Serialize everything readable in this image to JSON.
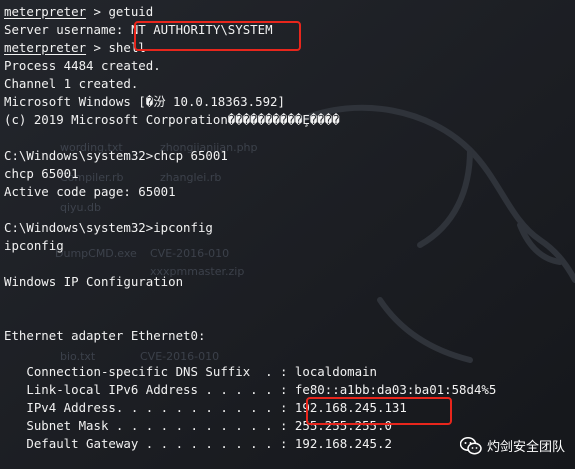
{
  "terminal": {
    "lines": [
      {
        "parts": [
          {
            "text": "meterpreter",
            "u": true
          },
          {
            "text": " > getuid"
          }
        ]
      },
      {
        "parts": [
          {
            "text": "Server username: NT AUTHORITY\\SYSTEM"
          }
        ]
      },
      {
        "parts": [
          {
            "text": "meterpreter",
            "u": true
          },
          {
            "text": " > shell"
          }
        ]
      },
      {
        "parts": [
          {
            "text": "Process 4484 created."
          }
        ]
      },
      {
        "parts": [
          {
            "text": "Channel 1 created."
          }
        ]
      },
      {
        "parts": [
          {
            "text": "Microsoft Windows [�汾 10.0.18363.592]"
          }
        ]
      },
      {
        "parts": [
          {
            "text": "(c) 2019 Microsoft Corporation����������Ȩ����"
          }
        ]
      },
      {
        "parts": [
          {
            "text": ""
          }
        ]
      },
      {
        "parts": [
          {
            "text": "C:\\Windows\\system32>chcp 65001"
          }
        ]
      },
      {
        "parts": [
          {
            "text": "chcp 65001"
          }
        ]
      },
      {
        "parts": [
          {
            "text": "Active code page: 65001"
          }
        ]
      },
      {
        "parts": [
          {
            "text": ""
          }
        ]
      },
      {
        "parts": [
          {
            "text": "C:\\Windows\\system32>ipconfig"
          }
        ]
      },
      {
        "parts": [
          {
            "text": "ipconfig"
          }
        ]
      },
      {
        "parts": [
          {
            "text": ""
          }
        ]
      },
      {
        "parts": [
          {
            "text": "Windows IP Configuration"
          }
        ]
      },
      {
        "parts": [
          {
            "text": ""
          }
        ]
      },
      {
        "parts": [
          {
            "text": ""
          }
        ]
      },
      {
        "parts": [
          {
            "text": "Ethernet adapter Ethernet0:"
          }
        ]
      },
      {
        "parts": [
          {
            "text": ""
          }
        ]
      },
      {
        "parts": [
          {
            "text": "   Connection-specific DNS Suffix  . : localdomain"
          }
        ]
      },
      {
        "parts": [
          {
            "text": "   Link-local IPv6 Address . . . . . : fe80::a1bb:da03:ba01:58d4%5"
          }
        ]
      },
      {
        "parts": [
          {
            "text": "   IPv4 Address. . . . . . . . . . . : 192.168.245.131"
          }
        ]
      },
      {
        "parts": [
          {
            "text": "   Subnet Mask . . . . . . . . . . . : 255.255.255.0"
          }
        ]
      },
      {
        "parts": [
          {
            "text": "   Default Gateway . . . . . . . . . : 192.168.245.2"
          }
        ]
      }
    ]
  },
  "background_ghost_text": [
    "wording.txt",
    "zhongjianjian.php",
    "Compiler.rb",
    "zhanglei.rb",
    "qiyu.db",
    "DumpCMD.exe",
    "CVE-2016-010",
    "xxxpmmaster.zip",
    "bio.txt",
    "CVE-2016-010"
  ],
  "watermark": {
    "text": "灼剑安全团队",
    "icon": "wechat-icon"
  },
  "colors": {
    "background": "#1c1e23",
    "text": "#f2f2f2",
    "highlight": "#e8261c"
  }
}
